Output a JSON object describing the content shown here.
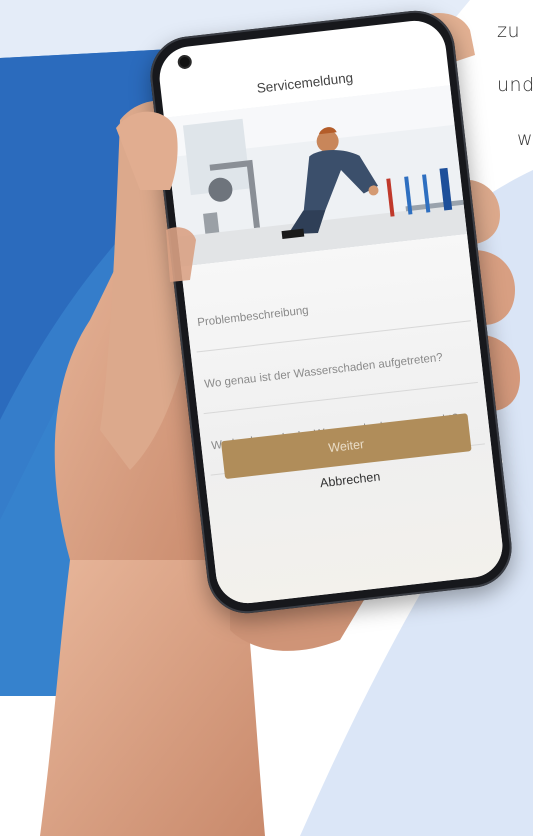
{
  "background": {
    "text_lines": [
      "zu",
      "und",
      "w"
    ],
    "colors": {
      "blue_dark": "#2a6fc0",
      "blue_mid": "#3b86d1",
      "blue_light": "#dde8f7"
    }
  },
  "app": {
    "title": "Servicemeldung",
    "hero_image": "technician-installing-pipes",
    "fields": [
      {
        "placeholder": "Problembeschreibung"
      },
      {
        "placeholder": "Wo genau ist der Wasserschaden aufgetreten?"
      },
      {
        "placeholder": "Wodurch wurde der Wasserschaden verursacht?"
      }
    ],
    "primary_button": "Weiter",
    "cancel_button": "Abbrechen",
    "accent_color": "#b08d5a"
  }
}
